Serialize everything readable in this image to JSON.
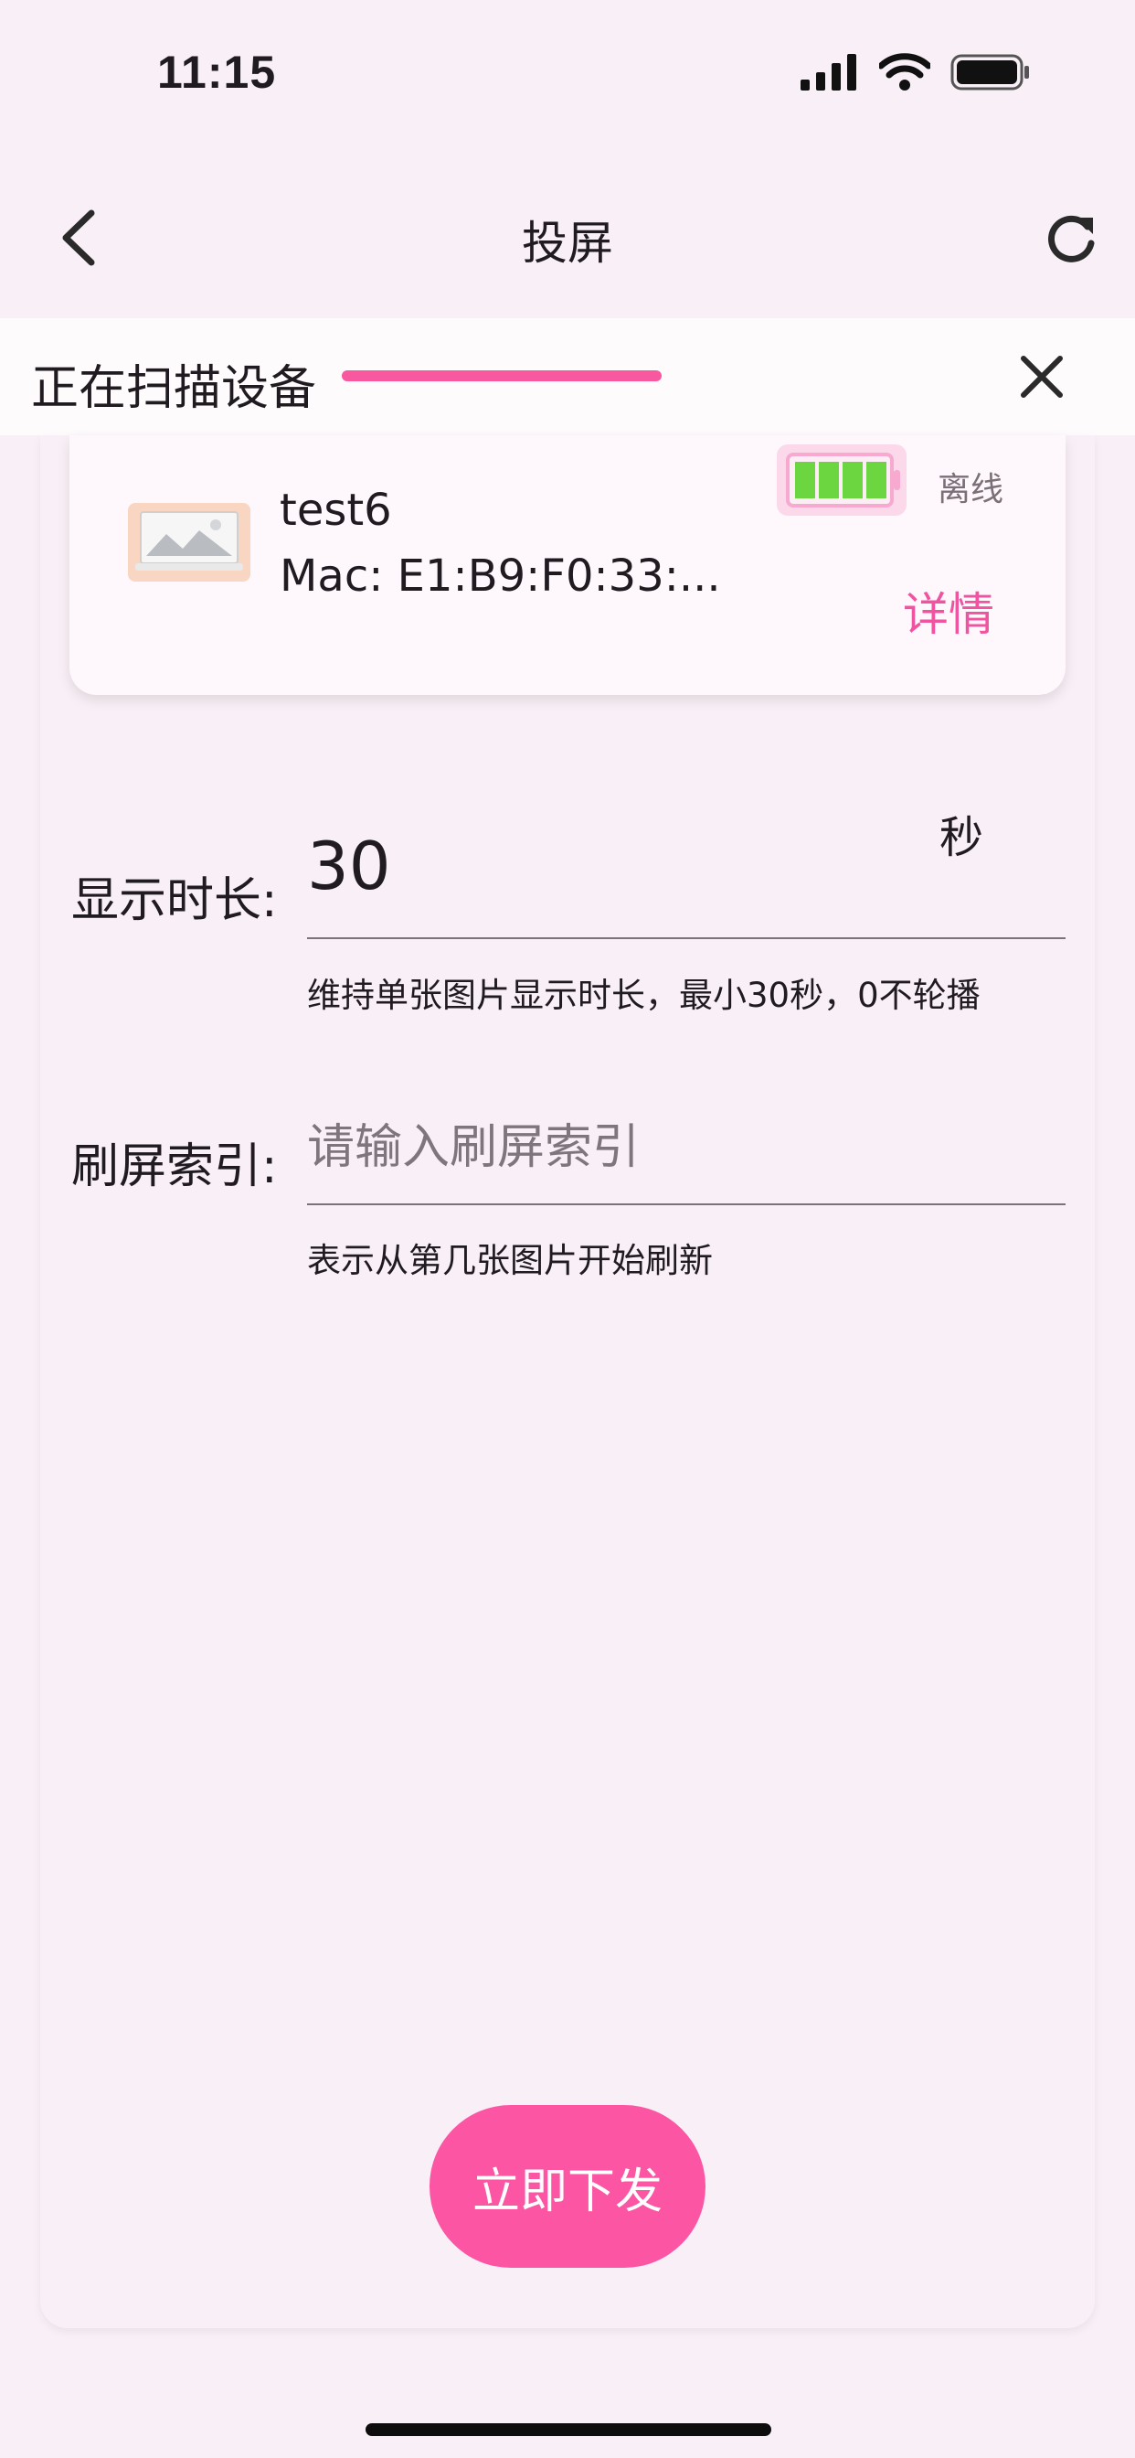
{
  "status_bar": {
    "time": "11:15",
    "icons": [
      "cellular-signal-icon",
      "wifi-icon",
      "battery-icon"
    ]
  },
  "app_bar": {
    "title": "投屏",
    "back_icon": "chevron-left-icon",
    "refresh_icon": "refresh-icon"
  },
  "scan": {
    "label": "正在扫描设备",
    "close_icon": "close-icon",
    "accent": "#f7589f"
  },
  "device": {
    "name": "test6",
    "mac": "Mac: E1:B9:F0:33:...",
    "status": "离线",
    "detail_label": "详情",
    "battery_level": 1.0,
    "battery_color": "#6bd63f"
  },
  "form": {
    "duration": {
      "label": "显示时长:",
      "value": "30",
      "unit": "秒",
      "help": "维持单张图片显示时长，最小30秒，0不轮播"
    },
    "index": {
      "label": "刷屏索引:",
      "placeholder": "请输入刷屏索引",
      "help": "表示从第几张图片开始刷新"
    }
  },
  "submit_label": "立即下发",
  "colors": {
    "background": "#f9eff6",
    "accent": "#fc55a4",
    "link": "#f053a0"
  }
}
